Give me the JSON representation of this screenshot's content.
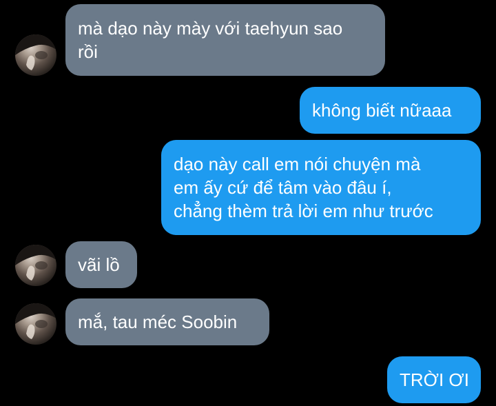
{
  "conversation": {
    "messages": [
      {
        "side": "received",
        "lines": [
          "mà dạo này mày với taehyun sao",
          "rồi"
        ]
      },
      {
        "side": "sent",
        "lines": [
          "không biết nữaaa"
        ]
      },
      {
        "side": "sent",
        "lines": [
          "dạo này call em nói chuyện mà",
          "em ấy cứ để tâm vào đâu í,",
          "chẳng thèm trả lời em như trước"
        ]
      },
      {
        "side": "received",
        "lines": [
          "vãi lồ"
        ]
      },
      {
        "side": "received",
        "lines": [
          "mắ, tau méc Soobin"
        ]
      },
      {
        "side": "sent",
        "lines": [
          "TRỜI ƠI"
        ]
      }
    ]
  },
  "colors": {
    "background": "#000000",
    "received_bubble": "#6b7a8a",
    "sent_bubble": "#1e9bf0",
    "text": "#ffffff"
  },
  "icons": {
    "avatar": "profile-photo-avatar"
  }
}
